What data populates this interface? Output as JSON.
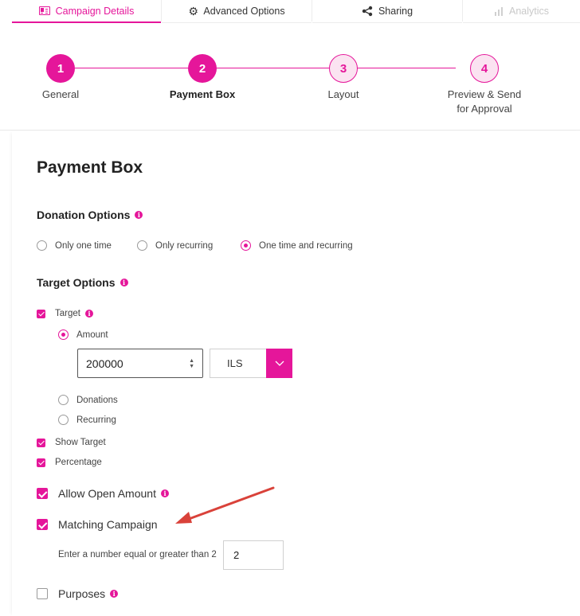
{
  "tabs": [
    {
      "label": "Campaign Details",
      "icon": "campaign-details-icon",
      "state": "active"
    },
    {
      "label": "Advanced Options",
      "icon": "gear-icon",
      "state": "normal"
    },
    {
      "label": "Sharing",
      "icon": "share-icon",
      "state": "normal"
    },
    {
      "label": "Analytics",
      "icon": "analytics-icon",
      "state": "disabled"
    }
  ],
  "stepper": {
    "steps": [
      {
        "number": "1",
        "label": "General",
        "state": "done"
      },
      {
        "number": "2",
        "label": "Payment Box",
        "state": "current"
      },
      {
        "number": "3",
        "label": "Layout",
        "state": "todo"
      },
      {
        "number": "4",
        "label_line1": "Preview & Send",
        "label_line2": "for Approval",
        "state": "todo"
      }
    ]
  },
  "page": {
    "title": "Payment Box"
  },
  "donation_options": {
    "title": "Donation Options",
    "options": [
      {
        "label": "Only one time",
        "selected": false
      },
      {
        "label": "Only recurring",
        "selected": false
      },
      {
        "label": "One time and recurring",
        "selected": true
      }
    ]
  },
  "target_options": {
    "title": "Target Options",
    "target_label": "Target",
    "target_checked": true,
    "amount_label": "Amount",
    "amount_value": "200000",
    "currency": "ILS",
    "donations_label": "Donations",
    "recurring_label": "Recurring",
    "show_target_label": "Show Target",
    "percentage_label": "Percentage"
  },
  "extras": {
    "allow_open_amount_label": "Allow Open Amount",
    "matching_campaign_label": "Matching Campaign",
    "matching_hint": "Enter a number equal or greater than 2",
    "matching_value": "2",
    "purposes_label": "Purposes"
  },
  "colors": {
    "accent": "#e5169a",
    "accent_light": "#fbe3f1",
    "annotation_arrow": "#d9423a"
  }
}
